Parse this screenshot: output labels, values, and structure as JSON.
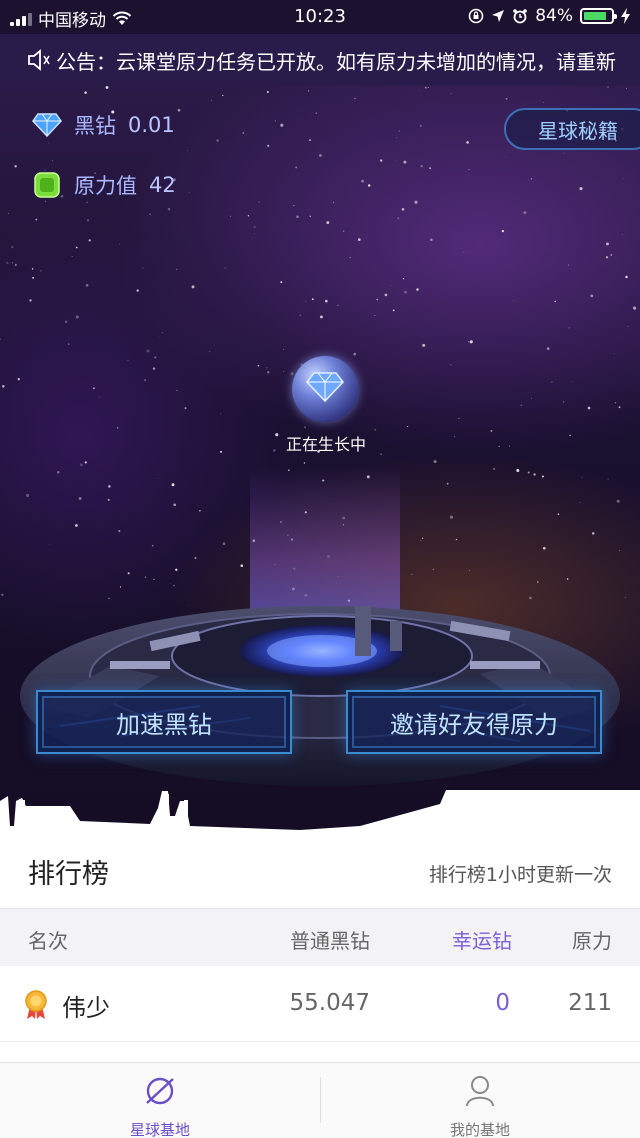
{
  "status_bar": {
    "carrier": "中国移动",
    "time": "10:23",
    "battery": "84%",
    "battery_level": 0.84
  },
  "notice": {
    "prefix": "公告：",
    "text": "云课堂原力任务已开放。如有原力未增加的情况，请重新"
  },
  "hero": {
    "black_diamond_label": "黑钻",
    "black_diamond_value": "0.01",
    "force_label": "原力值",
    "force_value": "42",
    "secret_button": "星球秘籍",
    "growing_text": "正在生长中",
    "accelerate_button": "加速黑钻",
    "invite_button": "邀请好友得原力"
  },
  "ranking": {
    "title": "排行榜",
    "note": "排行榜1小时更新一次",
    "columns": {
      "rank": "名次",
      "normal": "普通黑钻",
      "lucky": "幸运钻",
      "force": "原力"
    },
    "rows": [
      {
        "name": "伟少",
        "normal": "55.047",
        "lucky": "0",
        "force": "211"
      }
    ]
  },
  "tabbar": {
    "planet": "星球基地",
    "mine": "我的基地"
  },
  "colors": {
    "accent_purple": "#7b5fd6",
    "button_border": "#3a8bd0",
    "battery_green": "#4cd964"
  }
}
